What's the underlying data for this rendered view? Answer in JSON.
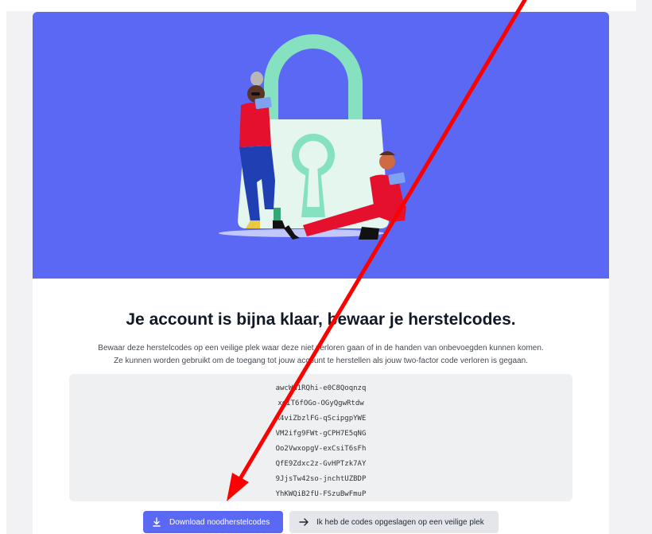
{
  "page": {
    "title": "Je account is bijna klaar, bewaar je herstelcodes.",
    "description": [
      "Bewaar deze herstelcodes op een veilige plek waar deze niet verloren gaan of in de handen van onbevoegden kunnen komen.",
      "Ze kunnen worden gebruikt om de toegang tot jouw account te herstellen als jouw two-factor code verloren is gegaan."
    ]
  },
  "hero": {
    "illustration": "padlock-with-two-people",
    "background_color": "#5b68f4"
  },
  "recovery_codes": [
    "awcWa1RQhi-e0C8Qoqnzq",
    "xeIT6fOGo-OGyQgwRtdw",
    "R4viZbzlFG-qScipgpYWE",
    "VM2ifg9FWt-gCPH7E5qNG",
    "Oo2VwxopgV-exCsiT6sFh",
    "QfE9Zdxc2z-GvHPTzk7AY",
    "9JjsTw42so-jnchtUZBDP",
    "YhKWQiB2fU-FSzuBwFmuP"
  ],
  "actions": {
    "download_label": "Download noodherstelcodes",
    "download_icon": "download-icon",
    "confirm_label": "Ik heb de codes opgeslagen op een veilige plek",
    "confirm_icon": "arrow-right-icon"
  },
  "overlay": {
    "annotation": "red-pointer-arrow",
    "color": "#ff0000"
  }
}
